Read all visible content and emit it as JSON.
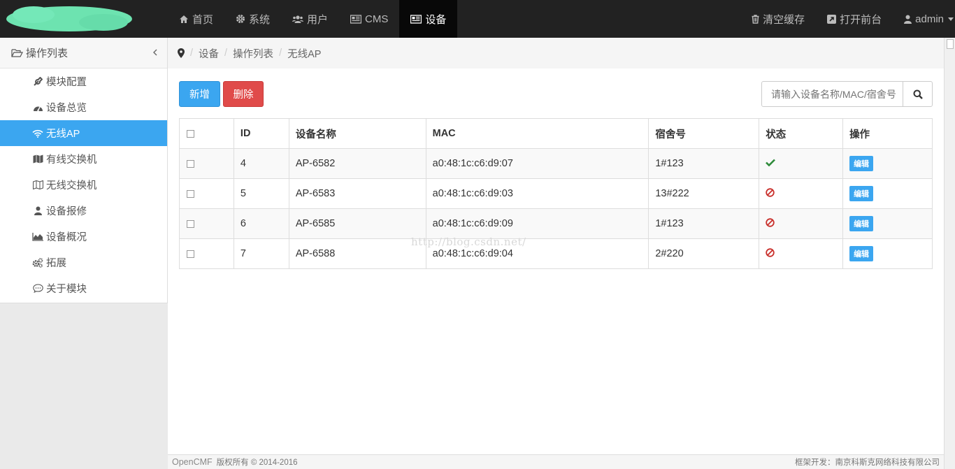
{
  "nav": {
    "items": [
      {
        "label": "首页",
        "icon": "home-icon",
        "active": false
      },
      {
        "label": "系统",
        "icon": "gear-icon",
        "active": false
      },
      {
        "label": "用户",
        "icon": "users-icon",
        "active": false
      },
      {
        "label": "CMS",
        "icon": "newspaper-icon",
        "active": false
      },
      {
        "label": "设备",
        "icon": "list-alt-icon",
        "active": true
      }
    ],
    "right": [
      {
        "label": "清空缓存",
        "icon": "trash-icon"
      },
      {
        "label": "打开前台",
        "icon": "external-link-icon"
      },
      {
        "label": "admin",
        "icon": "user-icon"
      }
    ]
  },
  "sidebar": {
    "title": "操作列表",
    "items": [
      {
        "label": "模块配置",
        "icon": "wrench-icon"
      },
      {
        "label": "设备总览",
        "icon": "dashboard-icon"
      },
      {
        "label": "无线AP",
        "icon": "wifi-icon",
        "active": true
      },
      {
        "label": "有线交换机",
        "icon": "map-icon"
      },
      {
        "label": "无线交换机",
        "icon": "map-outline-icon"
      },
      {
        "label": "设备报修",
        "icon": "user-icon"
      },
      {
        "label": "设备概况",
        "icon": "area-chart-icon"
      },
      {
        "label": "拓展",
        "icon": "cogs-icon"
      },
      {
        "label": "关于模块",
        "icon": "comment-icon"
      }
    ]
  },
  "breadcrumb": [
    "设备",
    "操作列表",
    "无线AP"
  ],
  "toolbar": {
    "add_label": "新增",
    "delete_label": "删除"
  },
  "search": {
    "placeholder": "请输入设备名称/MAC/宿舍号"
  },
  "table": {
    "headers": [
      "ID",
      "设备名称",
      "MAC",
      "宿舍号",
      "状态",
      "操作"
    ],
    "rows": [
      {
        "id": "4",
        "name": "AP-6582",
        "mac": "a0:48:1c:c6:d9:07",
        "dorm": "1#123",
        "status": "ok",
        "action": "编辑"
      },
      {
        "id": "5",
        "name": "AP-6583",
        "mac": "a0:48:1c:c6:d9:03",
        "dorm": "13#222",
        "status": "disabled",
        "action": "编辑"
      },
      {
        "id": "6",
        "name": "AP-6585",
        "mac": "a0:48:1c:c6:d9:09",
        "dorm": "1#123",
        "status": "disabled",
        "action": "编辑"
      },
      {
        "id": "7",
        "name": "AP-6588",
        "mac": "a0:48:1c:c6:d9:04",
        "dorm": "2#220",
        "status": "disabled",
        "action": "编辑"
      }
    ]
  },
  "watermark": "http://blog.csdn.net/",
  "footer": {
    "brand": "OpenCMF",
    "copyright": "版权所有 © 2014-2016",
    "credit": "框架开发：南京科斯克网络科技有限公司"
  },
  "colors": {
    "accent": "#3ba6f0",
    "danger": "#e04b4a",
    "navbar": "#222222",
    "ok": "#2e8b3a",
    "disabled": "#c9302c"
  }
}
